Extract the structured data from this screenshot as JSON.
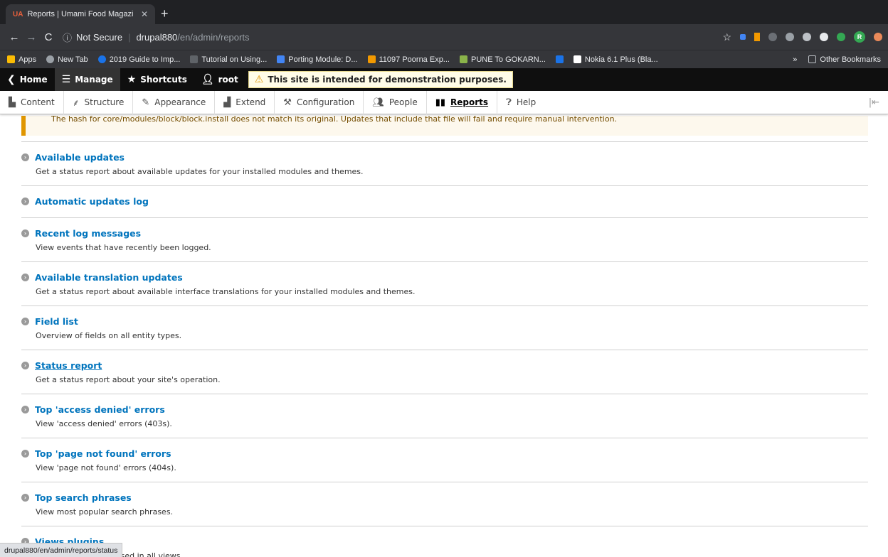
{
  "browser": {
    "tab_title": "Reports | Umami Food Magazi",
    "tab_favicon": "UA",
    "new_tab": "+",
    "back": "←",
    "forward": "→",
    "reload": "C",
    "security": "Not Secure",
    "url_host": "drupal880",
    "url_path": "/en/admin/reports",
    "status_url": "drupal880/en/admin/reports/status"
  },
  "bookmarks": {
    "items": [
      {
        "label": "Apps",
        "color": "#fbbc04"
      },
      {
        "label": "New Tab",
        "color": "#9aa0a6"
      },
      {
        "label": "2019 Guide to Imp...",
        "color": "#1a73e8"
      },
      {
        "label": "Tutorial on Using...",
        "color": "#5f6368"
      },
      {
        "label": "Porting Module: D...",
        "color": "#4285f4"
      },
      {
        "label": "11097 Poorna Exp...",
        "color": "#f29900"
      },
      {
        "label": "PUNE To GOKARN...",
        "color": "#8ab34a"
      },
      {
        "label": "",
        "color": "#1a73e8"
      },
      {
        "label": "Nokia 6.1 Plus (Bla...",
        "color": "#ffffff"
      }
    ],
    "more": "»",
    "other": "Other Bookmarks"
  },
  "drupal_toolbar": {
    "home": "Home",
    "manage": "Manage",
    "shortcuts": "Shortcuts",
    "user": "root",
    "demo_notice": "This site is intended for demonstration purposes."
  },
  "admin_menu": {
    "items": [
      {
        "label": "Content",
        "icon": "content-icon"
      },
      {
        "label": "Structure",
        "icon": "structure-icon"
      },
      {
        "label": "Appearance",
        "icon": "appearance-icon"
      },
      {
        "label": "Extend",
        "icon": "extend-icon"
      },
      {
        "label": "Configuration",
        "icon": "configuration-icon"
      },
      {
        "label": "People",
        "icon": "people-icon"
      },
      {
        "label": "Reports",
        "icon": "reports-icon"
      },
      {
        "label": "Help",
        "icon": "help-icon"
      }
    ]
  },
  "warning": "The hash for core/modules/block/block.install does not match its original. Updates that include that file will fail and require manual intervention.",
  "reports": [
    {
      "title": "Available updates",
      "desc": "Get a status report about available updates for your installed modules and themes."
    },
    {
      "title": "Automatic updates log",
      "desc": ""
    },
    {
      "title": "Recent log messages",
      "desc": "View events that have recently been logged."
    },
    {
      "title": "Available translation updates",
      "desc": "Get a status report about available interface translations for your installed modules and themes."
    },
    {
      "title": "Field list",
      "desc": "Overview of fields on all entity types."
    },
    {
      "title": "Status report",
      "desc": "Get a status report about your site's operation."
    },
    {
      "title": "Top 'access denied' errors",
      "desc": "View 'access denied' errors (403s)."
    },
    {
      "title": "Top 'page not found' errors",
      "desc": "View 'page not found' errors (404s)."
    },
    {
      "title": "Top search phrases",
      "desc": "View most popular search phrases."
    },
    {
      "title": "Views plugins",
      "desc": "Overview of plugins used in all views."
    }
  ]
}
